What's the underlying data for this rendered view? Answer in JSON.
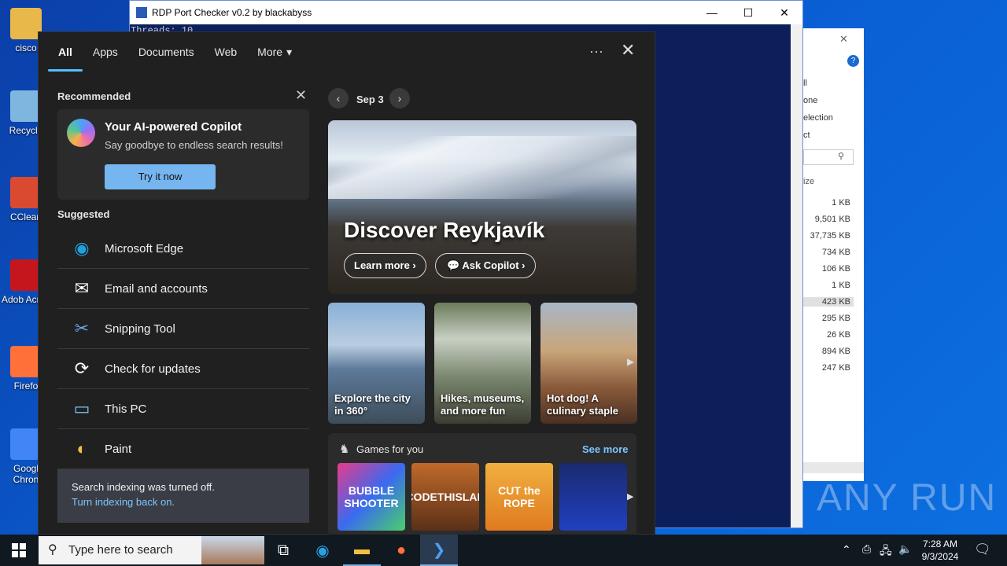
{
  "desktop": {
    "icons": [
      {
        "label": "cisco",
        "color": "#e8b84a"
      },
      {
        "label": "Recycle",
        "color": "#7db7e0"
      },
      {
        "label": "CClean",
        "color": "#d94a30"
      },
      {
        "label": "Adob Acrob",
        "color": "#c4161c"
      },
      {
        "label": "Firefo",
        "color": "#ff7139"
      },
      {
        "label": "Googl Chron",
        "color": "#4285f4"
      }
    ]
  },
  "rdp_window": {
    "title": "RDP Port Checker v0.2 by blackabyss",
    "console_line": "Threads: 10",
    "minimize": "—",
    "maximize": "☐",
    "close": "✕"
  },
  "explorer": {
    "menu": [
      "ll",
      "one",
      "election",
      "ct"
    ],
    "size_header": "ize",
    "sizes": [
      "1 KB",
      "9,501 KB",
      "37,735 KB",
      "734 KB",
      "106 KB",
      "1 KB",
      "423 KB",
      "295 KB",
      "26 KB",
      "894 KB",
      "247 KB"
    ],
    "selected_index": 6
  },
  "start_menu": {
    "tabs": [
      "All",
      "Apps",
      "Documents",
      "Web",
      "More"
    ],
    "active_tab": 0,
    "more_icon": "▾",
    "dots": "···",
    "close": "✕",
    "recommended_label": "Recommended",
    "copilot": {
      "title": "Your AI-powered Copilot",
      "subtitle": "Say goodbye to endless search results!",
      "button": "Try it now"
    },
    "suggested_label": "Suggested",
    "suggested": [
      {
        "label": "Microsoft Edge",
        "icon": "edge-icon",
        "glyph": "◉",
        "color": "#1fa0e0"
      },
      {
        "label": "Email and accounts",
        "icon": "mail-icon",
        "glyph": "✉",
        "color": "#ffffff"
      },
      {
        "label": "Snipping Tool",
        "icon": "scissors-icon",
        "glyph": "✂",
        "color": "#6aa8e8"
      },
      {
        "label": "Check for updates",
        "icon": "sync-icon",
        "glyph": "⟳",
        "color": "#ffffff"
      },
      {
        "label": "This PC",
        "icon": "computer-icon",
        "glyph": "▭",
        "color": "#7ec4f0"
      },
      {
        "label": "Paint",
        "icon": "paint-icon",
        "glyph": "◐",
        "color": "#f0c040"
      }
    ],
    "indexing": {
      "message": "Search indexing was turned off.",
      "link": "Turn indexing back on."
    },
    "date_nav": {
      "prev": "‹",
      "date": "Sep 3",
      "next": "›"
    },
    "hero": {
      "title": "Discover Reykjavík",
      "learn_more": "Learn more ›",
      "ask_copilot": "Ask Copilot ›"
    },
    "cards": [
      {
        "title": "Explore the city in 360°",
        "bg": "linear-gradient(180deg,#8ab0d8 0%,#b9cde0 35%,#5d7a9a 55%,#3e4d5a 100%)"
      },
      {
        "title": "Hikes, museums, and more fun",
        "bg": "linear-gradient(180deg,#6b7c5a 0%,#c8cfc4 30%,#7d8a72 60%,#3b3f33 100%)"
      },
      {
        "title": "Hot dog! A culinary staple",
        "bg": "linear-gradient(180deg,#a8b6c6 0%,#c9a57a 40%,#8a5a3a 70%,#4a3022 100%)"
      }
    ],
    "games": {
      "header": "Games for you",
      "see_more": "See more",
      "tiles": [
        {
          "label": "BUBBLE SHOOTER",
          "bg": "linear-gradient(135deg,#e83a8a,#3a6af0,#4ad06a)",
          "color": "#ffffff"
        },
        {
          "label": "CODETHISLAB",
          "bg": "linear-gradient(180deg,#c06a2a,#5a3018)",
          "color": "#ffffff"
        },
        {
          "label": "CUT the ROPE",
          "bg": "linear-gradient(180deg,#f0b040,#e07a20)",
          "color": "#ffffff"
        },
        {
          "label": "",
          "bg": "linear-gradient(180deg,#1a2a70,#2040c0)",
          "color": "#ffffff"
        }
      ]
    }
  },
  "taskbar": {
    "search_placeholder": "Type here to search",
    "time": "7:28 AM",
    "date": "9/3/2024"
  },
  "watermark": "ANY RUN"
}
